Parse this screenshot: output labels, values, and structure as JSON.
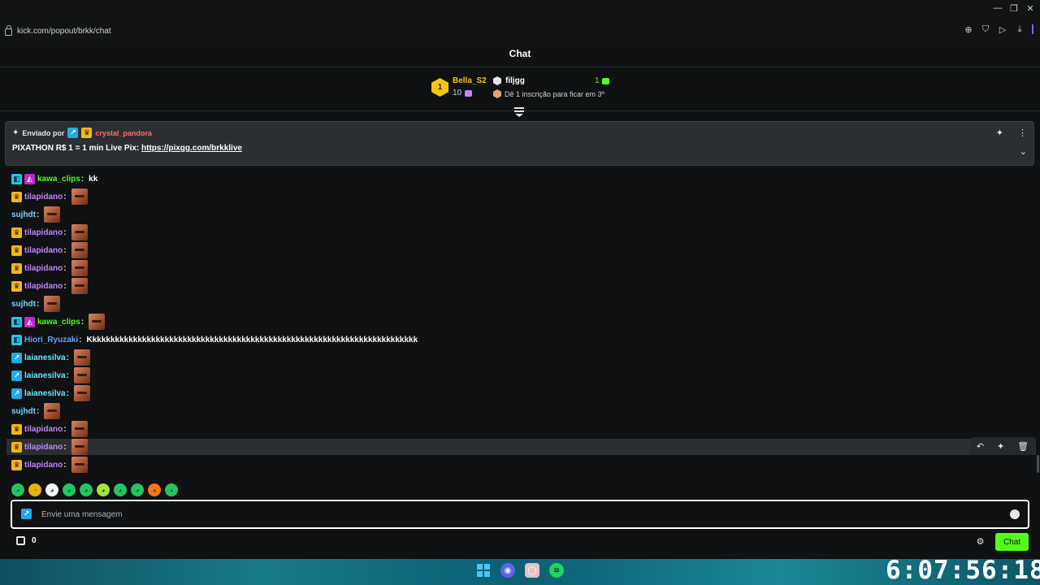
{
  "browser": {
    "url": "kick.com/popout/brkk/chat"
  },
  "chat": {
    "title": "Chat"
  },
  "leaderboard": {
    "first": {
      "rank": "1",
      "name": "Bella_S2",
      "count": "10"
    },
    "second": {
      "name": "filjgg",
      "count": "1",
      "hint": "Dê 1 inscrição para ficar em 3º"
    }
  },
  "pinned": {
    "sent_by_label": "Enviado por",
    "user": "crystal_pandora",
    "text_prefix": "PIXATHON R$ 1 = 1 min Live Pix:",
    "link": "https://pixgg.com/brkklive"
  },
  "messages": [
    {
      "user": "kawa_clips",
      "color": "#53fc18",
      "badges": [
        "vip",
        "og"
      ],
      "text": "kk",
      "emote": false
    },
    {
      "user": "tilapidano",
      "color": "#c084fc",
      "badges": [
        "crown"
      ],
      "text": "",
      "emote": true
    },
    {
      "user": "sujhdt",
      "color": "#7dd3fc",
      "badges": [],
      "text": "",
      "emote": true
    },
    {
      "user": "tilapidano",
      "color": "#c084fc",
      "badges": [
        "crown"
      ],
      "text": "",
      "emote": true
    },
    {
      "user": "tilapidano",
      "color": "#c084fc",
      "badges": [
        "crown"
      ],
      "text": "",
      "emote": true
    },
    {
      "user": "tilapidano",
      "color": "#c084fc",
      "badges": [
        "crown"
      ],
      "text": "",
      "emote": true
    },
    {
      "user": "tilapidano",
      "color": "#c084fc",
      "badges": [
        "crown"
      ],
      "text": "",
      "emote": true
    },
    {
      "user": "sujhdt",
      "color": "#7dd3fc",
      "badges": [],
      "text": "",
      "emote": true
    },
    {
      "user": "kawa_clips",
      "color": "#53fc18",
      "badges": [
        "vip",
        "og"
      ],
      "text": "",
      "emote": true
    },
    {
      "user": "Hiori_Ryuzaki",
      "color": "#60a5fa",
      "badges": [
        "vip"
      ],
      "text": "Kkkkkkkkkkkkkkkkkkkkkkkkkkkkkkkkkkkkkkkkkkkkkkkkkkkkkkkkkkkkkkkkkkkkkkkkk",
      "emote": false
    },
    {
      "user": "laianesilva",
      "color": "#67e8f9",
      "badges": [
        "sub"
      ],
      "text": "",
      "emote": true
    },
    {
      "user": "laianesilva",
      "color": "#67e8f9",
      "badges": [
        "sub"
      ],
      "text": "",
      "emote": true
    },
    {
      "user": "laianesilva",
      "color": "#67e8f9",
      "badges": [
        "sub"
      ],
      "text": "",
      "emote": true
    },
    {
      "user": "sujhdt",
      "color": "#7dd3fc",
      "badges": [],
      "text": "",
      "emote": true
    },
    {
      "user": "tilapidano",
      "color": "#c084fc",
      "badges": [
        "crown"
      ],
      "text": "",
      "emote": true
    },
    {
      "user": "tilapidano",
      "color": "#c084fc",
      "badges": [
        "crown"
      ],
      "text": "",
      "emote": true,
      "hover": true
    },
    {
      "user": "tilapidano",
      "color": "#c084fc",
      "badges": [
        "crown"
      ],
      "text": "",
      "emote": true
    }
  ],
  "input": {
    "placeholder": "Envie uma mensagem"
  },
  "footer": {
    "points": "0",
    "chat_button": "Chat"
  },
  "clock": "6:07:56:18",
  "colors": {
    "accent": "#53fc18",
    "background": "#0f1112",
    "panel": "#2b2f31"
  },
  "icons": {
    "lock": "lock-icon",
    "pin": "pin-icon",
    "more": "more-vertical-icon",
    "chevron": "chevron-down-icon",
    "undo": "undo-icon",
    "delete": "trash-icon",
    "emoji": "emoji-icon",
    "settings": "gear-icon",
    "store": "store-icon"
  }
}
